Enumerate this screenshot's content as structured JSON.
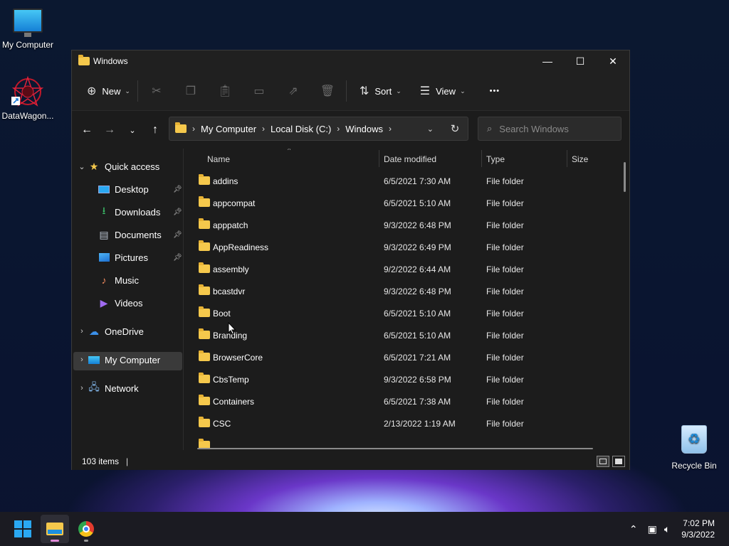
{
  "desktop": {
    "icons": [
      {
        "label": "My Computer"
      },
      {
        "label": "DataWagon..."
      },
      {
        "label": "Recycle Bin"
      }
    ]
  },
  "window": {
    "title": "Windows",
    "controls": {
      "minimize": "—",
      "maximize": "☐",
      "close": "✕"
    }
  },
  "toolbar": {
    "new_label": "New",
    "sort_label": "Sort",
    "view_label": "View",
    "more_label": "•••"
  },
  "address": {
    "crumbs": [
      "My Computer",
      "Local Disk (C:)",
      "Windows"
    ]
  },
  "search": {
    "placeholder": "Search Windows"
  },
  "nav_pane": {
    "quick_access": "Quick access",
    "items": [
      "Desktop",
      "Downloads",
      "Documents",
      "Pictures",
      "Music",
      "Videos"
    ],
    "onedrive": "OneDrive",
    "my_computer": "My Computer",
    "network": "Network"
  },
  "columns": {
    "name": "Name",
    "date": "Date modified",
    "type": "Type",
    "size": "Size"
  },
  "files": [
    {
      "name": "addins",
      "date": "6/5/2021 7:30 AM",
      "type": "File folder"
    },
    {
      "name": "appcompat",
      "date": "6/5/2021 5:10 AM",
      "type": "File folder"
    },
    {
      "name": "apppatch",
      "date": "9/3/2022 6:48 PM",
      "type": "File folder"
    },
    {
      "name": "AppReadiness",
      "date": "9/3/2022 6:49 PM",
      "type": "File folder"
    },
    {
      "name": "assembly",
      "date": "9/2/2022 6:44 AM",
      "type": "File folder"
    },
    {
      "name": "bcastdvr",
      "date": "9/3/2022 6:48 PM",
      "type": "File folder"
    },
    {
      "name": "Boot",
      "date": "6/5/2021 5:10 AM",
      "type": "File folder"
    },
    {
      "name": "Branding",
      "date": "6/5/2021 5:10 AM",
      "type": "File folder"
    },
    {
      "name": "BrowserCore",
      "date": "6/5/2021 7:21 AM",
      "type": "File folder"
    },
    {
      "name": "CbsTemp",
      "date": "9/3/2022 6:58 PM",
      "type": "File folder"
    },
    {
      "name": "Containers",
      "date": "6/5/2021 7:38 AM",
      "type": "File folder"
    },
    {
      "name": "CSC",
      "date": "2/13/2022 1:19 AM",
      "type": "File folder"
    }
  ],
  "status": {
    "count": "103 items",
    "separator": "|"
  },
  "taskbar": {
    "time": "7:02 PM",
    "date": "9/3/2022"
  },
  "colors": {
    "accent": "#2aa8f2",
    "folder": "#f5c84c"
  }
}
